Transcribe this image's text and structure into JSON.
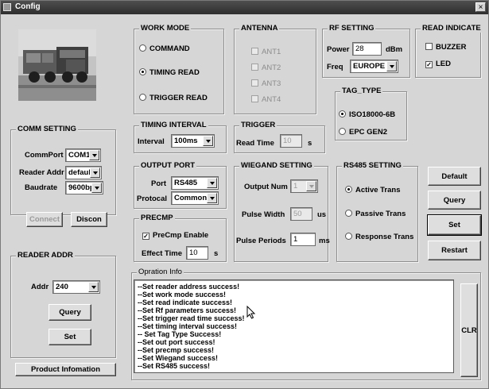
{
  "window": {
    "title": "Config",
    "close_label": "×"
  },
  "comm": {
    "title": "COMM SETTING",
    "commport_label": "CommPort",
    "commport_value": "COM1",
    "reader_addr_label": "Reader Addr",
    "reader_addr_value": "default",
    "baudrate_label": "Baudrate",
    "baudrate_value": "9600bp",
    "connect_label": "Connect",
    "disconnect_label": "Discon"
  },
  "reader_addr": {
    "title": "READER ADDR",
    "addr_label": "Addr",
    "addr_value": "240",
    "query_label": "Query",
    "set_label": "Set"
  },
  "product_info_label": "Product Infomation",
  "work_mode": {
    "title": "WORK MODE",
    "options": [
      {
        "label": "COMMAND",
        "selected": false
      },
      {
        "label": "TIMING READ",
        "selected": true
      },
      {
        "label": "TRIGGER READ",
        "selected": false
      }
    ]
  },
  "antenna": {
    "title": "ANTENNA",
    "items": [
      "ANT1",
      "ANT2",
      "ANT3",
      "ANT4"
    ]
  },
  "rf": {
    "title": "RF SETTING",
    "power_label": "Power",
    "power_value": "28",
    "power_unit": "dBm",
    "freq_label": "Freq",
    "freq_value": "EUROPE"
  },
  "read_indicate": {
    "title": "READ INDICATE",
    "buzzer_label": "BUZZER",
    "buzzer_checked": false,
    "led_label": "LED",
    "led_checked": true
  },
  "tag_type": {
    "title": "TAG_TYPE",
    "options": [
      {
        "label": "ISO18000-6B",
        "selected": true
      },
      {
        "label": "EPC GEN2",
        "selected": false
      }
    ]
  },
  "timing": {
    "title": "TIMING INTERVAL",
    "interval_label": "Interval",
    "interval_value": "100ms"
  },
  "trigger": {
    "title": "TRIGGER",
    "read_time_label": "Read Time",
    "read_time_value": "10",
    "unit": "s"
  },
  "output_port": {
    "title": "OUTPUT PORT",
    "port_label": "Port",
    "port_value": "RS485",
    "protocal_label": "Protocal",
    "protocal_value": "Common"
  },
  "precmp": {
    "title": "PRECMP",
    "enable_label": "PreCmp Enable",
    "enable_checked": true,
    "effect_label": "Effect Time",
    "effect_value": "10",
    "unit": "s"
  },
  "wiegand": {
    "title": "WIEGAND SETTING",
    "output_num_label": "Output Num",
    "output_num_value": "1",
    "pulse_width_label": "Pulse Width",
    "pulse_width_value": "50",
    "pulse_width_unit": "us",
    "pulse_periods_label": "Pulse Periods",
    "pulse_periods_value": "1",
    "pulse_periods_unit": "ms"
  },
  "rs485": {
    "title": "RS485 SETTING",
    "options": [
      {
        "label": "Active Trans",
        "selected": true
      },
      {
        "label": "Passive Trans",
        "selected": false
      },
      {
        "label": "Response Trans",
        "selected": false
      }
    ]
  },
  "actions": {
    "default_label": "Default",
    "query_label": "Query",
    "set_label": "Set",
    "restart_label": "Restart"
  },
  "operation": {
    "title": "Opration Info",
    "clear_label": "CLR",
    "lines": [
      "--Set reader address success!",
      "--Set work mode success!",
      "--Set read indicate success!",
      "--Set Rf parameters success!",
      "--Set trigger read time success!",
      "--Set timing interval success!",
      "-- Set Tag Type Success!",
      "--Set out port success!",
      "--Set precmp success!",
      "--Set Wiegand success!",
      "--Set RS485 success!"
    ]
  }
}
